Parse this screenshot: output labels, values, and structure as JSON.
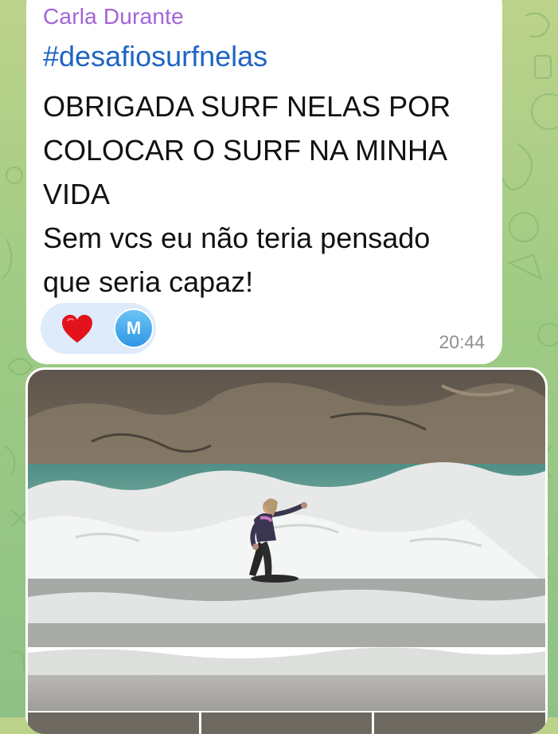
{
  "message": {
    "sender": "Carla Durante",
    "hashtag": "#desafiosurfnelas",
    "text": "OBRIGADA SURF NELAS POR\nCOLOCAR O SURF NA MINHA\nVIDA\nSem vcs eu não teria pensado\nque seria capaz!",
    "time": "20:44",
    "reactions": [
      {
        "icon": "heart-icon",
        "color": "#e3131b"
      },
      {
        "avatar_initial": "M",
        "color": "#2f97e4"
      }
    ]
  },
  "photo": {
    "subject": "surfer-on-wave",
    "thumbnail_count": 3
  },
  "colors": {
    "sender": "#a463d8",
    "hashtag": "#1f64c3",
    "bubble": "#ffffff",
    "reaction_pill": "#ddebfb",
    "time": "#8a8f94"
  }
}
